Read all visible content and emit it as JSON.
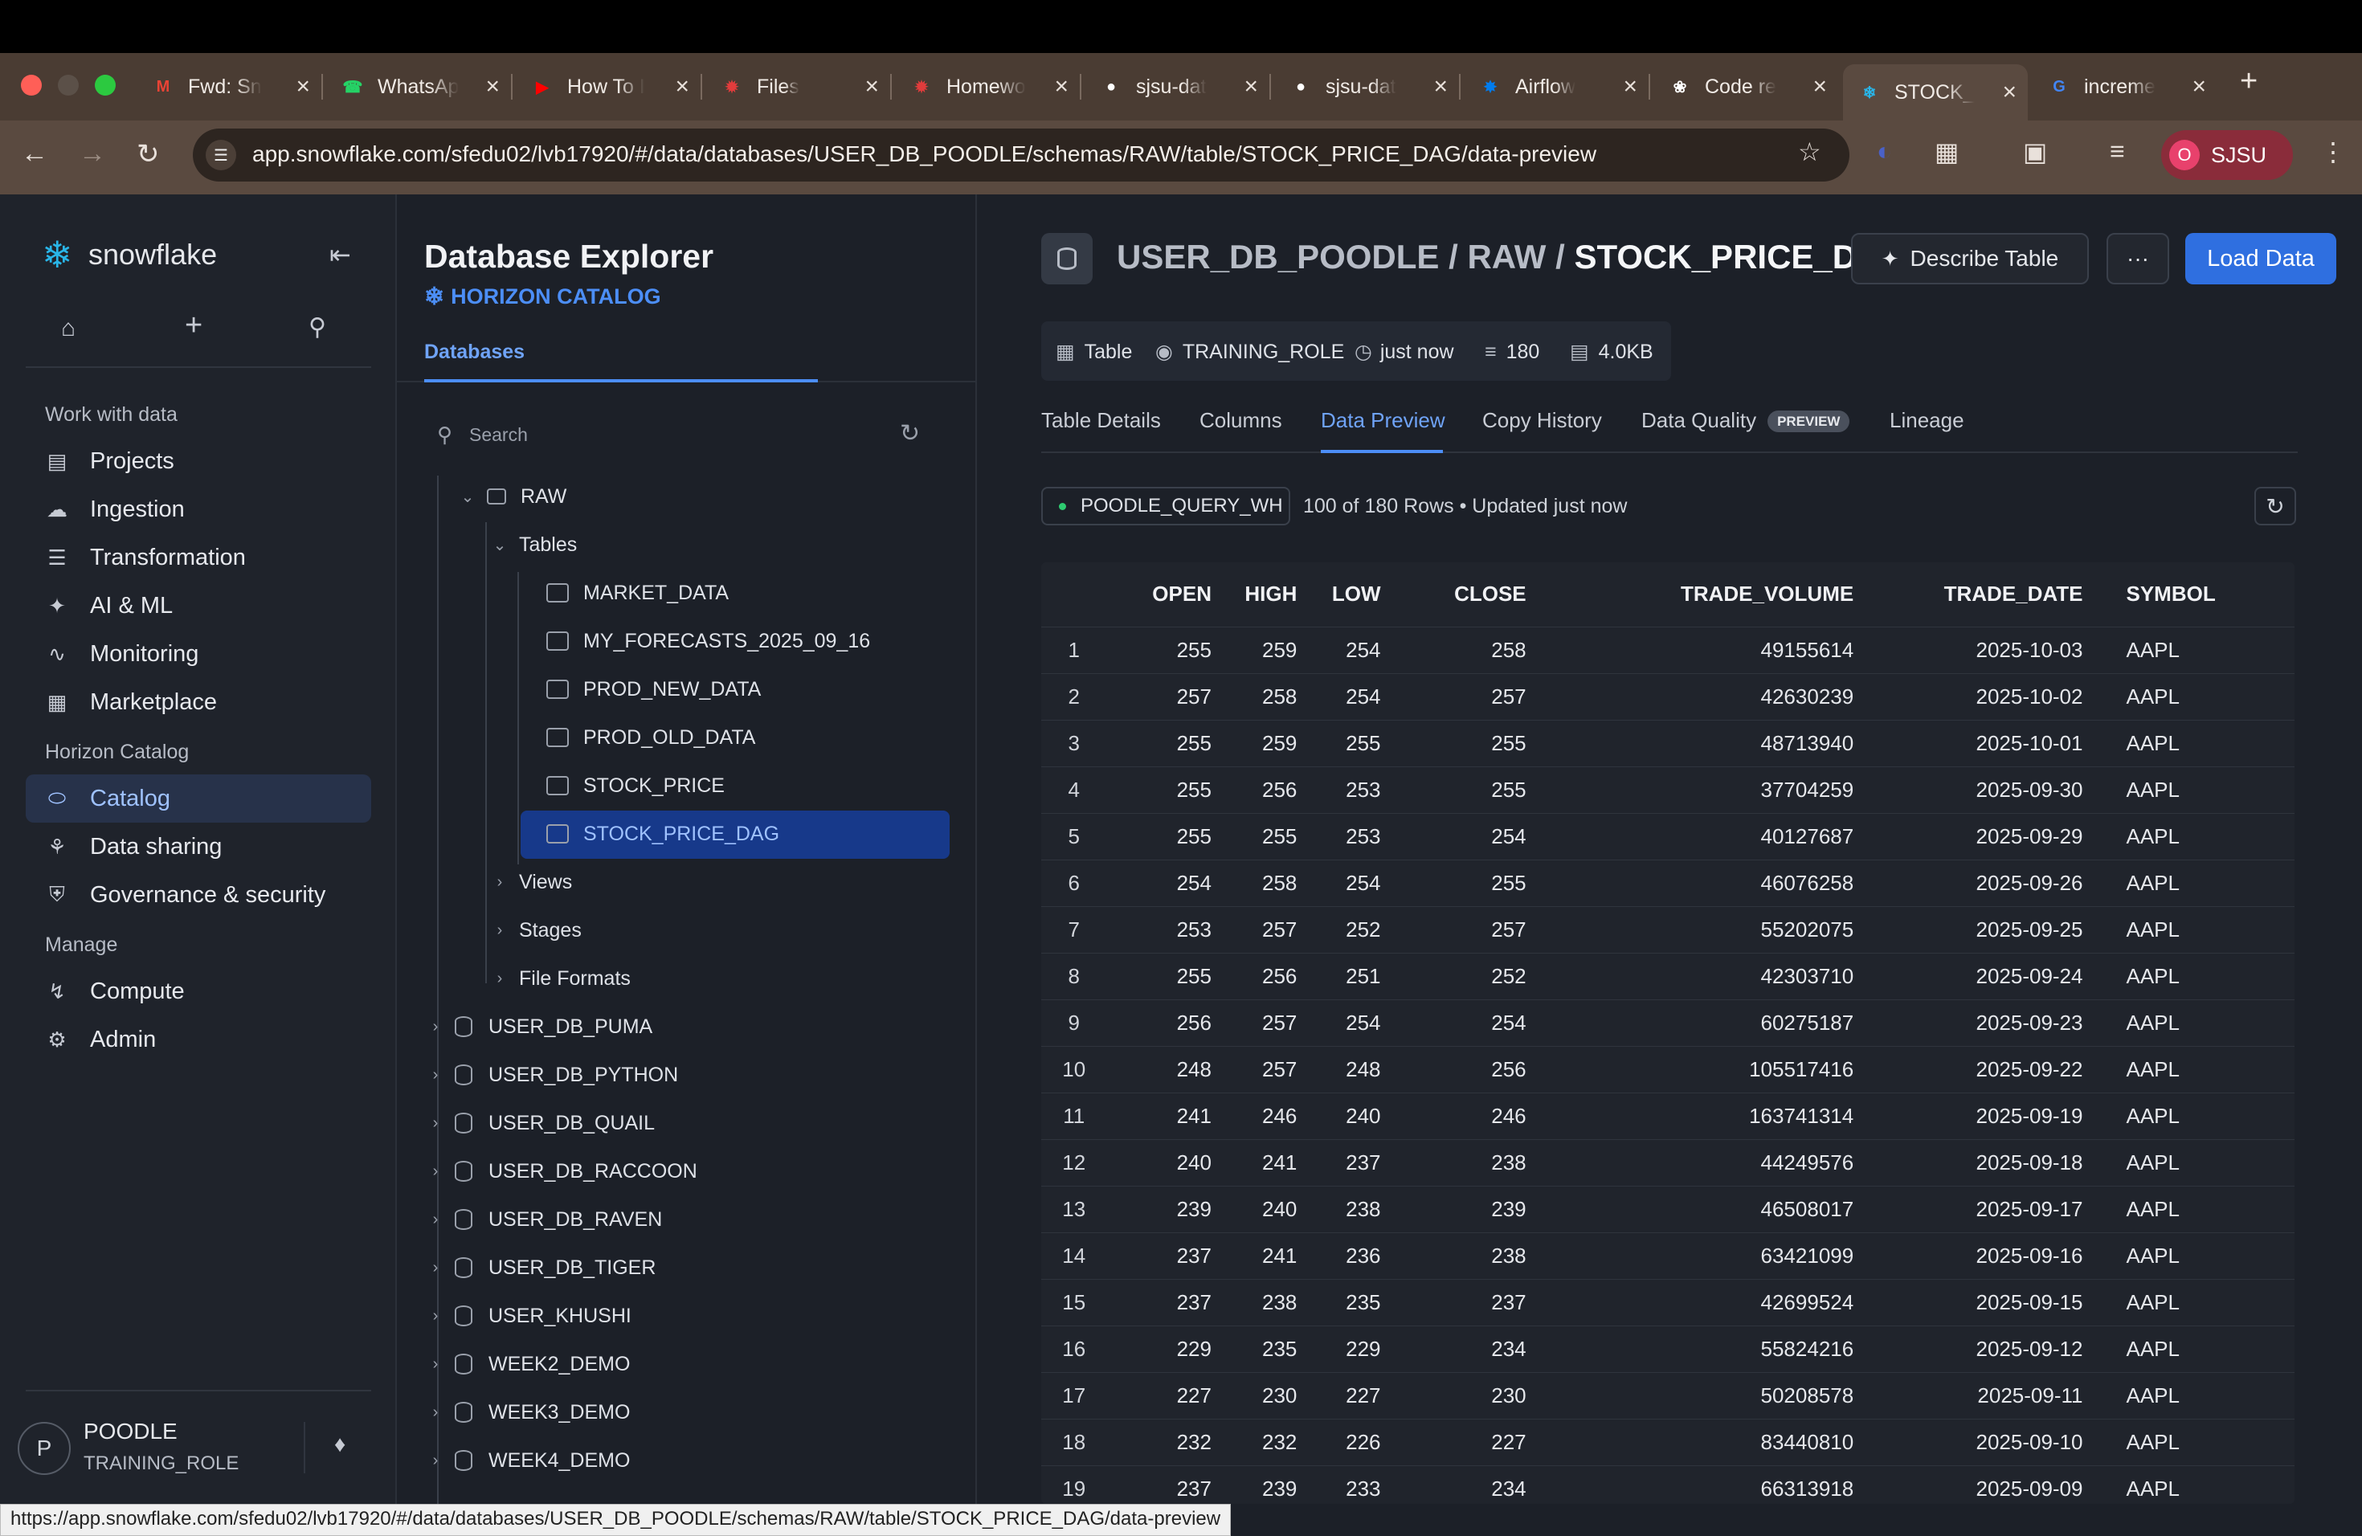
{
  "browser": {
    "tabs": [
      {
        "label": "Fwd: Sn",
        "icon": "gmail-icon",
        "color": "#ea4335"
      },
      {
        "label": "WhatsAp",
        "icon": "whatsapp-icon",
        "color": "#25d366"
      },
      {
        "label": "How To I",
        "icon": "youtube-icon",
        "color": "#ff0000"
      },
      {
        "label": "Files",
        "icon": "canvas-icon",
        "color": "#e13c3c"
      },
      {
        "label": "Homewo",
        "icon": "canvas-icon",
        "color": "#e13c3c"
      },
      {
        "label": "sjsu-dat",
        "icon": "github-icon",
        "color": "#ffffff"
      },
      {
        "label": "sjsu-dat",
        "icon": "github-icon",
        "color": "#ffffff"
      },
      {
        "label": "Airflow",
        "icon": "airflow-icon",
        "color": "#017cee"
      },
      {
        "label": "Code re",
        "icon": "openai-icon",
        "color": "#ffffff"
      },
      {
        "label": "STOCK_",
        "icon": "snowflake-icon",
        "color": "#29b5e8"
      },
      {
        "label": "increme",
        "icon": "google-icon",
        "color": "#4285f4"
      }
    ],
    "new_tab": "+",
    "url": "app.snowflake.com/sfedu02/lvb17920/#/data/databases/USER_DB_POODLE/schemas/RAW/table/STOCK_PRICE_DAG/data-preview",
    "profile_initial": "O",
    "profile_name": "SJSU",
    "status_url": "https://app.snowflake.com/sfedu02/lvb17920/#/data/databases/USER_DB_POODLE/schemas/RAW/table/STOCK_PRICE_DAG/data-preview"
  },
  "sidebar": {
    "logo": "snowflake",
    "sections": [
      {
        "heading": "Work with data",
        "items": [
          {
            "label": "Projects",
            "icon": "projects-icon"
          },
          {
            "label": "Ingestion",
            "icon": "ingestion-icon"
          },
          {
            "label": "Transformation",
            "icon": "transformation-icon"
          },
          {
            "label": "AI & ML",
            "icon": "ai-ml-icon"
          },
          {
            "label": "Monitoring",
            "icon": "monitoring-icon"
          },
          {
            "label": "Marketplace",
            "icon": "marketplace-icon"
          }
        ]
      },
      {
        "heading": "Horizon Catalog",
        "items": [
          {
            "label": "Catalog",
            "icon": "catalog-icon"
          },
          {
            "label": "Data sharing",
            "icon": "data-sharing-icon"
          },
          {
            "label": "Governance & security",
            "icon": "shield-icon"
          }
        ]
      },
      {
        "heading": "Manage",
        "items": [
          {
            "label": "Compute",
            "icon": "bolt-icon"
          },
          {
            "label": "Admin",
            "icon": "admin-icon"
          }
        ]
      }
    ],
    "user": {
      "initial": "P",
      "name": "POODLE",
      "role": "TRAINING_ROLE"
    }
  },
  "explorer": {
    "title": "Database Explorer",
    "subtitle": "HORIZON CATALOG",
    "tab": "Databases",
    "search_placeholder": "Search",
    "schema": "RAW",
    "tables_label": "Tables",
    "tables": [
      "MARKET_DATA",
      "MY_FORECASTS_2025_09_16",
      "PROD_NEW_DATA",
      "PROD_OLD_DATA",
      "STOCK_PRICE",
      "STOCK_PRICE_DAG"
    ],
    "folders": [
      "Views",
      "Stages",
      "File Formats"
    ],
    "databases": [
      "USER_DB_PUMA",
      "USER_DB_PYTHON",
      "USER_DB_QUAIL",
      "USER_DB_RACCOON",
      "USER_DB_RAVEN",
      "USER_DB_TIGER",
      "USER_KHUSHI",
      "WEEK2_DEMO",
      "WEEK3_DEMO",
      "WEEK4_DEMO"
    ]
  },
  "main": {
    "breadcrumb_db": "USER_DB_POODLE",
    "breadcrumb_schema": "RAW",
    "breadcrumb_table": "STOCK_PRICE_DAG",
    "sep": "/",
    "describe_button": "Describe Table",
    "more_button": "···",
    "load_button": "Load Data",
    "meta": {
      "type": "Table",
      "role": "TRAINING_ROLE",
      "updated": "just now",
      "rows": "180",
      "size": "4.0KB"
    },
    "tabs": [
      "Table Details",
      "Columns",
      "Data Preview",
      "Copy History",
      "Data Quality",
      "Lineage"
    ],
    "preview_badge": "PREVIEW",
    "warehouse": "POODLE_QUERY_WH",
    "rows_info": "100 of 180 Rows • Updated just now",
    "columns": [
      "OPEN",
      "HIGH",
      "LOW",
      "CLOSE",
      "TRADE_VOLUME",
      "TRADE_DATE",
      "SYMBOL"
    ],
    "rows": [
      [
        "1",
        "255",
        "259",
        "254",
        "258",
        "49155614",
        "2025-10-03",
        "AAPL"
      ],
      [
        "2",
        "257",
        "258",
        "254",
        "257",
        "42630239",
        "2025-10-02",
        "AAPL"
      ],
      [
        "3",
        "255",
        "259",
        "255",
        "255",
        "48713940",
        "2025-10-01",
        "AAPL"
      ],
      [
        "4",
        "255",
        "256",
        "253",
        "255",
        "37704259",
        "2025-09-30",
        "AAPL"
      ],
      [
        "5",
        "255",
        "255",
        "253",
        "254",
        "40127687",
        "2025-09-29",
        "AAPL"
      ],
      [
        "6",
        "254",
        "258",
        "254",
        "255",
        "46076258",
        "2025-09-26",
        "AAPL"
      ],
      [
        "7",
        "253",
        "257",
        "252",
        "257",
        "55202075",
        "2025-09-25",
        "AAPL"
      ],
      [
        "8",
        "255",
        "256",
        "251",
        "252",
        "42303710",
        "2025-09-24",
        "AAPL"
      ],
      [
        "9",
        "256",
        "257",
        "254",
        "254",
        "60275187",
        "2025-09-23",
        "AAPL"
      ],
      [
        "10",
        "248",
        "257",
        "248",
        "256",
        "105517416",
        "2025-09-22",
        "AAPL"
      ],
      [
        "11",
        "241",
        "246",
        "240",
        "246",
        "163741314",
        "2025-09-19",
        "AAPL"
      ],
      [
        "12",
        "240",
        "241",
        "237",
        "238",
        "44249576",
        "2025-09-18",
        "AAPL"
      ],
      [
        "13",
        "239",
        "240",
        "238",
        "239",
        "46508017",
        "2025-09-17",
        "AAPL"
      ],
      [
        "14",
        "237",
        "241",
        "236",
        "238",
        "63421099",
        "2025-09-16",
        "AAPL"
      ],
      [
        "15",
        "237",
        "238",
        "235",
        "237",
        "42699524",
        "2025-09-15",
        "AAPL"
      ],
      [
        "16",
        "229",
        "235",
        "229",
        "234",
        "55824216",
        "2025-09-12",
        "AAPL"
      ],
      [
        "17",
        "227",
        "230",
        "227",
        "230",
        "50208578",
        "2025-09-11",
        "AAPL"
      ],
      [
        "18",
        "232",
        "232",
        "226",
        "227",
        "83440810",
        "2025-09-10",
        "AAPL"
      ],
      [
        "19",
        "237",
        "239",
        "233",
        "234",
        "66313918",
        "2025-09-09",
        "AAPL"
      ]
    ]
  },
  "colors": {
    "accent": "#4c8ef7",
    "selected": "#17398a",
    "load_button": "#2f6fe0",
    "sidebar_selected": "#27324a"
  }
}
